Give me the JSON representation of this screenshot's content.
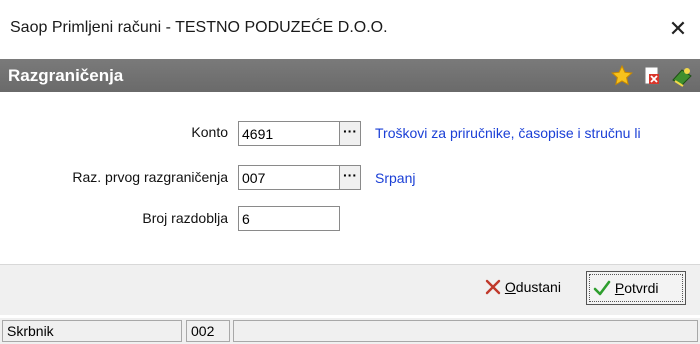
{
  "window": {
    "title": "Saop Primljeni računi - TESTNO PODUZEĆE D.O.O.",
    "close_glyph": "✕"
  },
  "header": {
    "title": "Razgraničenja",
    "icons": [
      "star-icon",
      "delete-document-icon",
      "book-icon"
    ]
  },
  "form": {
    "konto": {
      "label": "Konto",
      "value": "4691",
      "lookup": "···",
      "description": "Troškovi za priručnike, časopise i stručnu li"
    },
    "prvo_razgranicenje": {
      "label": "Raz. prvog razgraničenja",
      "value": "007",
      "lookup": "···",
      "description": "Srpanj"
    },
    "broj_razdoblja": {
      "label": "Broj razdoblja",
      "value": "6"
    }
  },
  "buttons": {
    "cancel": {
      "mnemonic": "O",
      "rest": "dustani",
      "icon": "x-icon",
      "color": "#c0392b"
    },
    "confirm": {
      "mnemonic": "P",
      "rest": "otvrdi",
      "icon": "check-icon",
      "color": "#2e9e2e"
    }
  },
  "statusbar": {
    "label": "Skrbnik",
    "code": "002",
    "extra": ""
  }
}
